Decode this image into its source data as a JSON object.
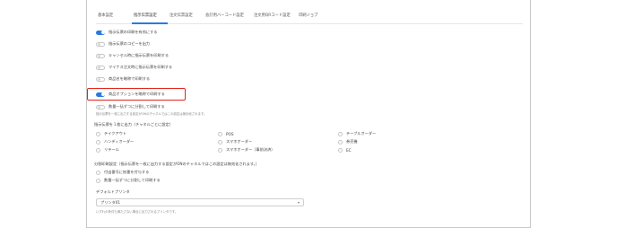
{
  "tabs": [
    "基本設定",
    "指示伝票設定",
    "注文伝票設定",
    "会計用バーコード設定",
    "注文用QRコード設定",
    "印刷ジョブ"
  ],
  "active_tab_index": 1,
  "toggles": [
    {
      "label": "指示伝票の印刷を有効にする",
      "on": true
    },
    {
      "label": "指示伝票のコピーを出力",
      "on": false
    },
    {
      "label": "キャンセル時に指示伝票を印刷する",
      "on": false
    },
    {
      "label": "マイナス注文時に指示伝票を印刷する",
      "on": false
    },
    {
      "label": "商品名を略称で印刷する",
      "on": false
    },
    {
      "label": "商品オプションを略称で印刷する",
      "on": true
    },
    {
      "label": "数量一括ずつに分割して印刷する",
      "on": false
    }
  ],
  "toggle_note": "指示伝票を一枚に出力する設定がONのチャネルではこの設定は無効化されます。",
  "channel_section_title": "指示伝票を１枚に出力（チャネルごとに設定）",
  "channels": [
    "テイクアウト",
    "POS",
    "テーブルオーダー",
    "ハンディオーダー",
    "スマホオーダー",
    "券売機",
    "リテール",
    "スマホオーダー（事前決済）",
    "EC"
  ],
  "split_section_title": "分割印刷設定（指示伝票を一枚に出力する設定がONのチャネルではこの設定は無効化されます。）",
  "split_options": [
    {
      "label": "付出番号に枝番を付与する",
      "on": false
    },
    {
      "label": "数量一括ずつに分割して印刷する",
      "on": false
    }
  ],
  "printer_label": "デフォルトプリンタ",
  "printer_value": "プリンタ01",
  "printer_note": "いずれの条件も満たさない場合に出力されるプリンタです。",
  "colors": {
    "accent": "#2a7ae2",
    "highlight": "#e0241f"
  }
}
